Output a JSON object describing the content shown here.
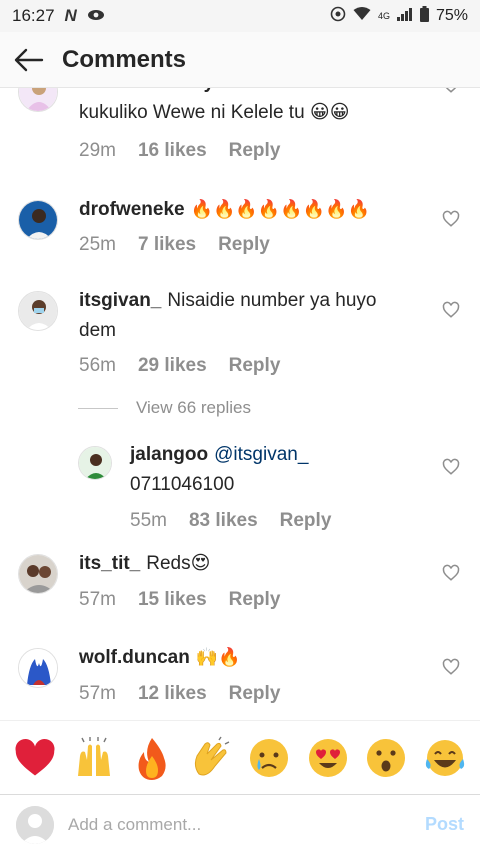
{
  "status_bar": {
    "time": "16:27",
    "network": "4G",
    "battery": "75%",
    "icons": [
      "netflix-n-icon",
      "eye-icon",
      "sync-icon",
      "wifi-icon",
      "signal-icon",
      "battery-icon"
    ]
  },
  "header": {
    "title": "Comments",
    "back_icon": "arrow-left-icon"
  },
  "comments": [
    {
      "username": "chriskirwa",
      "text": "Huyu ni memeee mazuri kukuliko Wewe ni Kelele tu 😀😀",
      "line1": "chriskirwa Huyu ni memeee mazuri",
      "line2": "kukuliko Wewe ni Kelele tu 😀😀",
      "time": "29m",
      "likes": "16 likes",
      "reply": "Reply"
    },
    {
      "username": "drofweneke",
      "text": "🔥🔥🔥🔥🔥🔥🔥🔥",
      "time": "25m",
      "likes": "7 likes",
      "reply": "Reply"
    },
    {
      "username": "itsgivan_",
      "text": "Nisaidie number ya huyo",
      "text2": "dem",
      "time": "56m",
      "likes": "29 likes",
      "reply": "Reply"
    },
    {
      "username": "jalangoo",
      "mention": "@itsgivan_",
      "text": "0711046100",
      "time": "55m",
      "likes": "83 likes",
      "reply": "Reply"
    },
    {
      "username": "its_tit_",
      "text": "Reds😍",
      "time": "57m",
      "likes": "15 likes",
      "reply": "Reply"
    },
    {
      "username": "wolf.duncan",
      "text": "🙌🔥",
      "time": "57m",
      "likes": "12 likes",
      "reply": "Reply"
    }
  ],
  "view_replies": "View 66 replies",
  "emoji_bar": [
    "❤️",
    "🙌",
    "🔥",
    "👏",
    "😢",
    "😍",
    "😮",
    "😂"
  ],
  "composer": {
    "placeholder": "Add a comment...",
    "post_label": "Post"
  },
  "colors": {
    "link": "#003569",
    "meta": "#8e8e8e",
    "post_disabled": "#b3dbff",
    "heart_red": "#ed4956"
  }
}
